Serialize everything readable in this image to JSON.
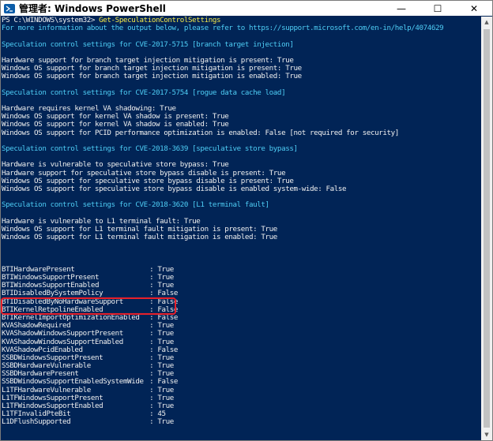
{
  "window": {
    "title": "管理者: Windows PowerShell",
    "controls": {
      "minimize": "—",
      "maximize": "☐",
      "close": "✕"
    }
  },
  "console": {
    "prompt": "PS C:\\WINDOWS\\system32> ",
    "command": "Get-SpeculationControlSettings",
    "lines": [
      {
        "text": "For more information about the output below, please refer to https://support.microsoft.com/en-in/help/4074629",
        "style": "cyan"
      },
      {
        "text": "",
        "style": "blank"
      },
      {
        "text": "Speculation control settings for CVE-2017-5715 [branch target injection]",
        "style": "cyan"
      },
      {
        "text": "",
        "style": "blank"
      },
      {
        "text": "Hardware support for branch target injection mitigation is present: True",
        "style": ""
      },
      {
        "text": "Windows OS support for branch target injection mitigation is present: True",
        "style": ""
      },
      {
        "text": "Windows OS support for branch target injection mitigation is enabled: True",
        "style": ""
      },
      {
        "text": "",
        "style": "blank"
      },
      {
        "text": "Speculation control settings for CVE-2017-5754 [rogue data cache load]",
        "style": "cyan"
      },
      {
        "text": "",
        "style": "blank"
      },
      {
        "text": "Hardware requires kernel VA shadowing: True",
        "style": ""
      },
      {
        "text": "Windows OS support for kernel VA shadow is present: True",
        "style": ""
      },
      {
        "text": "Windows OS support for kernel VA shadow is enabled: True",
        "style": ""
      },
      {
        "text": "Windows OS support for PCID performance optimization is enabled: False [not required for security]",
        "style": ""
      },
      {
        "text": "",
        "style": "blank"
      },
      {
        "text": "Speculation control settings for CVE-2018-3639 [speculative store bypass]",
        "style": "cyan"
      },
      {
        "text": "",
        "style": "blank"
      },
      {
        "text": "Hardware is vulnerable to speculative store bypass: True",
        "style": ""
      },
      {
        "text": "Hardware support for speculative store bypass disable is present: True",
        "style": ""
      },
      {
        "text": "Windows OS support for speculative store bypass disable is present: True",
        "style": ""
      },
      {
        "text": "Windows OS support for speculative store bypass disable is enabled system-wide: False",
        "style": ""
      },
      {
        "text": "",
        "style": "blank"
      },
      {
        "text": "Speculation control settings for CVE-2018-3620 [L1 terminal fault]",
        "style": "cyan"
      },
      {
        "text": "",
        "style": "blank"
      },
      {
        "text": "Hardware is vulnerable to L1 terminal fault: True",
        "style": ""
      },
      {
        "text": "Windows OS support for L1 terminal fault mitigation is present: True",
        "style": ""
      },
      {
        "text": "Windows OS support for L1 terminal fault mitigation is enabled: True",
        "style": ""
      },
      {
        "text": "",
        "style": "blank"
      },
      {
        "text": "",
        "style": "blank"
      },
      {
        "text": "",
        "style": "blank"
      }
    ],
    "properties": [
      {
        "name": "BTIHardwarePresent",
        "value": "True"
      },
      {
        "name": "BTIWindowsSupportPresent",
        "value": "True"
      },
      {
        "name": "BTIWindowsSupportEnabled",
        "value": "True"
      },
      {
        "name": "BTIDisabledBySystemPolicy",
        "value": "False"
      },
      {
        "name": "BTIDisabledByNoHardwareSupport",
        "value": "False"
      },
      {
        "name": "BTIKernelRetpolineEnabled",
        "value": "False"
      },
      {
        "name": "BTIKernelImportOptimizationEnabled",
        "value": "False"
      },
      {
        "name": "KVAShadowRequired",
        "value": "True"
      },
      {
        "name": "KVAShadowWindowsSupportPresent",
        "value": "True"
      },
      {
        "name": "KVAShadowWindowsSupportEnabled",
        "value": "True"
      },
      {
        "name": "KVAShadowPcidEnabled",
        "value": "False"
      },
      {
        "name": "SSBDWindowsSupportPresent",
        "value": "True"
      },
      {
        "name": "SSBDHardwareVulnerable",
        "value": "True"
      },
      {
        "name": "SSBDHardwarePresent",
        "value": "True"
      },
      {
        "name": "SSBDWindowsSupportEnabledSystemWide",
        "value": "False"
      },
      {
        "name": "L1TFHardwareVulnerable",
        "value": "True"
      },
      {
        "name": "L1TFWindowsSupportPresent",
        "value": "True"
      },
      {
        "name": "L1TFWindowsSupportEnabled",
        "value": "True"
      },
      {
        "name": "L1TFInvalidPteBit",
        "value": "45"
      },
      {
        "name": "L1DFlushSupported",
        "value": "True"
      }
    ],
    "separator": " : "
  },
  "colors": {
    "background": "#012456",
    "text": "#f0f0f0",
    "cyan": "#4ecdf5",
    "command": "#f5e94a",
    "highlight": "#e8202a"
  },
  "icons": {
    "app": "powershell-icon",
    "scroll_up": "chevron-up-icon",
    "scroll_down": "chevron-down-icon"
  }
}
